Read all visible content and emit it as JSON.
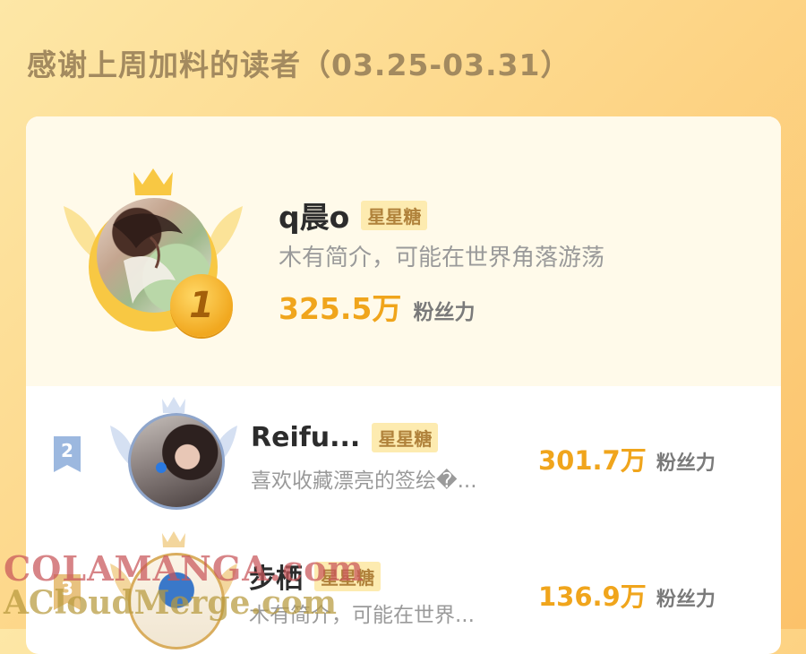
{
  "header": {
    "title": "感谢上周加料的读者（03.25-03.31）"
  },
  "readers": [
    {
      "rank": "1",
      "name": "q晨o",
      "badge": "星星糖",
      "bio": "木有简介，可能在世界角落游荡",
      "fans_value": "325.5万",
      "fans_label": "粉丝力"
    },
    {
      "rank": "2",
      "name": "Reifu...",
      "badge": "星星糖",
      "bio": "喜欢收藏漂亮的签绘�...",
      "fans_value": "301.7万",
      "fans_label": "粉丝力"
    },
    {
      "rank": "3",
      "name": "步栖",
      "badge": "星星糖",
      "bio": "木有简介，可能在世界...",
      "fans_value": "136.9万",
      "fans_label": "粉丝力"
    }
  ],
  "watermark": {
    "line1": "COLAMANGA.com",
    "line2": "ACloudMerge.com"
  },
  "colors": {
    "accent": "#f0a51c",
    "badge_bg": "#fdebb0",
    "badge_text": "#b0823b",
    "background": "#fdd78a"
  }
}
